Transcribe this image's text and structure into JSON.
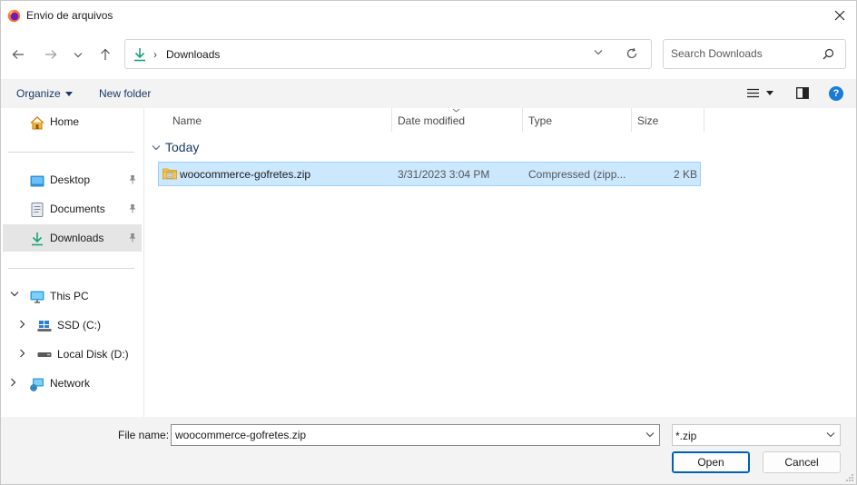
{
  "window": {
    "title": "Envio de arquivos"
  },
  "address": {
    "separator": "›",
    "crumb": "Downloads"
  },
  "search": {
    "placeholder": "Search Downloads"
  },
  "toolbar": {
    "organize_label": "Organize",
    "new_folder_label": "New folder",
    "help_label": "?"
  },
  "sidebar": {
    "items": [
      {
        "label": "Home",
        "icon": "home-icon"
      },
      {
        "label": "Desktop",
        "icon": "desktop-icon",
        "pinned": true
      },
      {
        "label": "Documents",
        "icon": "documents-icon",
        "pinned": true
      },
      {
        "label": "Downloads",
        "icon": "downloads-icon",
        "pinned": true,
        "selected": true
      },
      {
        "label": "This PC",
        "icon": "computer-icon",
        "expanded": true
      },
      {
        "label": "SSD (C:)",
        "icon": "drive-icon"
      },
      {
        "label": "Local Disk (D:)",
        "icon": "disk-icon"
      },
      {
        "label": "Network",
        "icon": "network-icon"
      }
    ]
  },
  "columns": [
    "Name",
    "Date modified",
    "Type",
    "Size"
  ],
  "group": {
    "label": "Today"
  },
  "files": [
    {
      "name": "woocommerce-gofretes.zip",
      "date": "3/31/2023 3:04 PM",
      "type": "Compressed (zipp...",
      "size": "2 KB",
      "selected": true
    }
  ],
  "bottom": {
    "file_name_label": "File name:",
    "file_name_value": "woocommerce-gofretes.zip",
    "filter_value": "*.zip",
    "open_label": "Open",
    "cancel_label": "Cancel"
  },
  "colors": {
    "accent": "#005fb8",
    "selection": "#cce8ff",
    "selection_border": "#99d1ff",
    "bar_background": "#f3f3f3"
  }
}
